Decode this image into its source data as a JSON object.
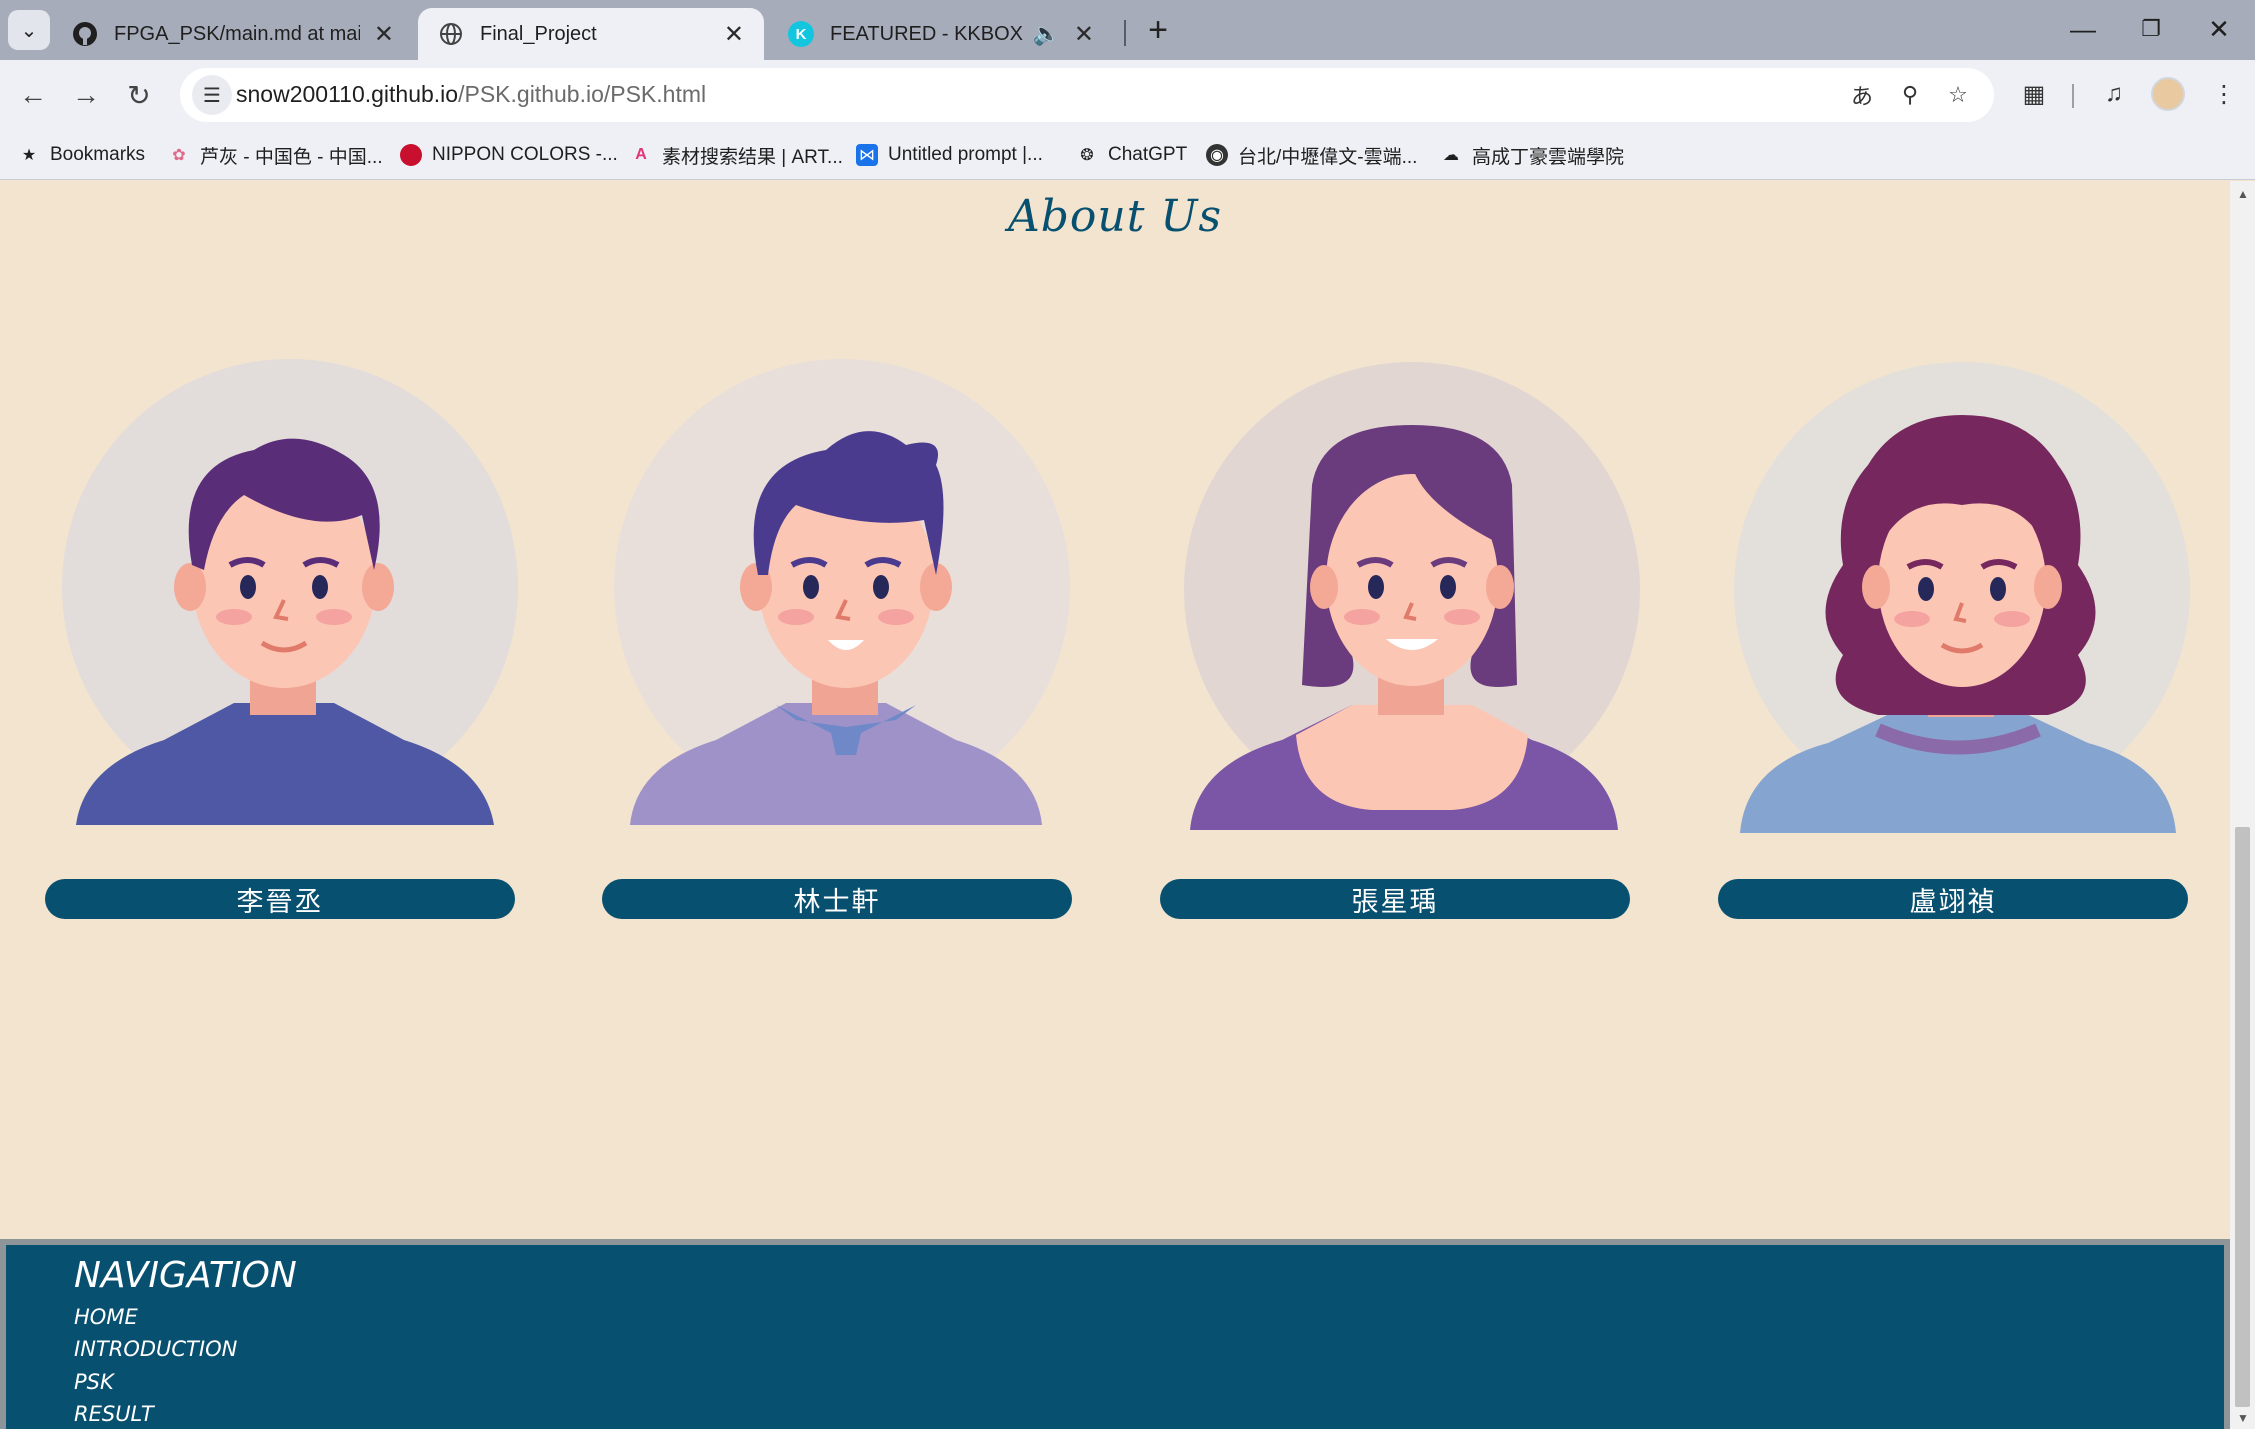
{
  "browser": {
    "tabs": [
      {
        "title": "FPGA_PSK/main.md at main ·",
        "favicon": "github-icon"
      },
      {
        "title": "Final_Project",
        "favicon": "globe-icon"
      },
      {
        "title": "FEATURED - KKBOX Web P",
        "favicon": "kkbox-icon"
      }
    ],
    "url_host": "snow200110.github.io",
    "url_path": "/PSK.github.io/PSK.html",
    "bookmarks": [
      {
        "label": "Bookmarks",
        "icon": "star-icon"
      },
      {
        "label": "芦灰 - 中国色 - 中国...",
        "icon": "flower-icon"
      },
      {
        "label": "NIPPON COLORS -...",
        "icon": "red-dot-icon"
      },
      {
        "label": "素材搜索结果 | ART...",
        "icon": "art-icon"
      },
      {
        "label": "Untitled prompt |...",
        "icon": "bow-icon"
      },
      {
        "label": "ChatGPT",
        "icon": "chatgpt-icon"
      },
      {
        "label": "台北/中壢偉文-雲端...",
        "icon": "globe-icon"
      },
      {
        "label": "高成丁豪雲端學院",
        "icon": "cloud-icon"
      }
    ]
  },
  "page": {
    "title": "About Us",
    "members": [
      {
        "name": "李晉丞"
      },
      {
        "name": "林士軒"
      },
      {
        "name": "張星瑀"
      },
      {
        "name": "盧翊禎"
      }
    ],
    "footer": {
      "title": "NAVIGATION",
      "links": [
        "HOME",
        "INTRODUCTION",
        "PSK",
        "RESULT"
      ]
    }
  },
  "colors": {
    "page_bg": "#f2e4cf",
    "accent": "#08506f",
    "chrome_tabstrip": "#a7acba",
    "chrome_toolbar": "#eef0f5"
  }
}
